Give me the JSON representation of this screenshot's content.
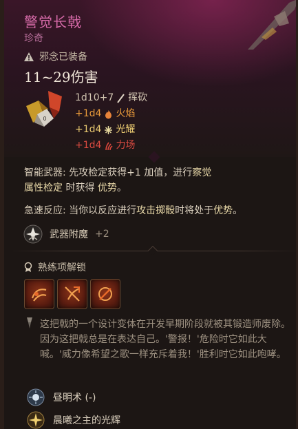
{
  "item": {
    "name": "警觉长戟",
    "rarity": "珍奇",
    "equip_status": "邪念已装备",
    "damage_range": "11~29伤害"
  },
  "damage_lines": [
    {
      "text": "1d10+7",
      "type": "挥砍",
      "icon": "slash-icon"
    },
    {
      "text": "+1d4",
      "type": "火焰",
      "icon": "fire-icon"
    },
    {
      "text": "+1d4",
      "type": "光耀",
      "icon": "radiant-icon"
    },
    {
      "text": "+1d4",
      "type": "力场",
      "icon": "force-icon"
    }
  ],
  "properties": {
    "alert_label": "智能武器:",
    "alert_text_1": "先攻检定获得+1 加值，进行",
    "alert_kw_1": "察觉",
    "alert_kw_2": "属性检定",
    "alert_text_2": "时获得",
    "alert_kw_3": "优势",
    "alert_end": "。",
    "haste_label": "急速反应:",
    "haste_text_1": "当你以反应进行",
    "haste_kw_1": "攻击掷骰",
    "haste_text_2": "时将处于",
    "haste_kw_2": "优势",
    "haste_end": "。"
  },
  "enchant": {
    "label": "武器附魔",
    "value": "+2"
  },
  "proficiency": {
    "label": "熟练项解锁",
    "icons": [
      "weapon-action-icon-1",
      "weapon-action-icon-2",
      "weapon-action-icon-3"
    ]
  },
  "flavor_text": "这把戟的一个设计变体在开发早期阶段就被其锻造师废除。因为这把戟总是在表达自己。'警报！'危险时它如此大喊。'威力像希望之歌一样充斥着我！'胜利时它如此咆哮。",
  "spells": [
    {
      "name": "昼明术 (-)",
      "icon": "daylight-spell-icon"
    },
    {
      "name": "晨曦之主的光辉",
      "icon": "radiance-dawnmaster-icon"
    }
  ],
  "colors": {
    "title": "#d66aa8",
    "rarity": "#b86e9a",
    "fire": "#e89a3a",
    "radiant": "#e8c870",
    "force": "#d94a40"
  }
}
